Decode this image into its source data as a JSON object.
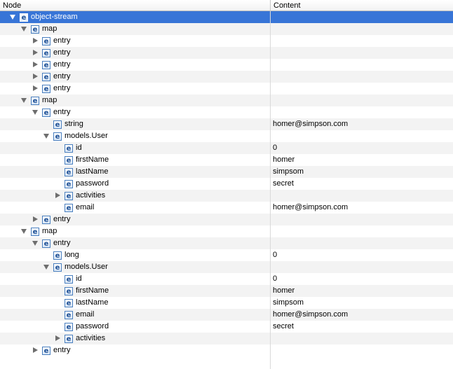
{
  "header": {
    "node_label": "Node",
    "content_label": "Content"
  },
  "icon_letter": "e",
  "rows": [
    {
      "label": "object-stream",
      "content": "",
      "level": 0,
      "state": "open",
      "selected": true
    },
    {
      "label": "map",
      "content": "",
      "level": 1,
      "state": "open"
    },
    {
      "label": "entry",
      "content": "",
      "level": 2,
      "state": "closed"
    },
    {
      "label": "entry",
      "content": "",
      "level": 2,
      "state": "closed"
    },
    {
      "label": "entry",
      "content": "",
      "level": 2,
      "state": "closed"
    },
    {
      "label": "entry",
      "content": "",
      "level": 2,
      "state": "closed"
    },
    {
      "label": "entry",
      "content": "",
      "level": 2,
      "state": "closed"
    },
    {
      "label": "map",
      "content": "",
      "level": 1,
      "state": "open"
    },
    {
      "label": "entry",
      "content": "",
      "level": 2,
      "state": "open"
    },
    {
      "label": "string",
      "content": "homer@simpson.com",
      "level": 3,
      "state": "none"
    },
    {
      "label": "models.User",
      "content": "",
      "level": 3,
      "state": "open"
    },
    {
      "label": "id",
      "content": "0",
      "level": 4,
      "state": "none"
    },
    {
      "label": "firstName",
      "content": "homer",
      "level": 4,
      "state": "none"
    },
    {
      "label": "lastName",
      "content": "simpsom",
      "level": 4,
      "state": "none"
    },
    {
      "label": "password",
      "content": "secret",
      "level": 4,
      "state": "none"
    },
    {
      "label": "activities",
      "content": "",
      "level": 4,
      "state": "closed"
    },
    {
      "label": "email",
      "content": "homer@simpson.com",
      "level": 4,
      "state": "none"
    },
    {
      "label": "entry",
      "content": "",
      "level": 2,
      "state": "closed"
    },
    {
      "label": "map",
      "content": "",
      "level": 1,
      "state": "open"
    },
    {
      "label": "entry",
      "content": "",
      "level": 2,
      "state": "open"
    },
    {
      "label": "long",
      "content": "0",
      "level": 3,
      "state": "none"
    },
    {
      "label": "models.User",
      "content": "",
      "level": 3,
      "state": "open"
    },
    {
      "label": "id",
      "content": "0",
      "level": 4,
      "state": "none"
    },
    {
      "label": "firstName",
      "content": "homer",
      "level": 4,
      "state": "none"
    },
    {
      "label": "lastName",
      "content": "simpsom",
      "level": 4,
      "state": "none"
    },
    {
      "label": "email",
      "content": "homer@simpson.com",
      "level": 4,
      "state": "none"
    },
    {
      "label": "password",
      "content": "secret",
      "level": 4,
      "state": "none"
    },
    {
      "label": "activities",
      "content": "",
      "level": 4,
      "state": "closed"
    },
    {
      "label": "entry",
      "content": "",
      "level": 2,
      "state": "closed"
    }
  ],
  "colors": {
    "selection": "#3875d7",
    "alt_row": "#f3f3f3",
    "icon_border": "#4a7fbf"
  }
}
